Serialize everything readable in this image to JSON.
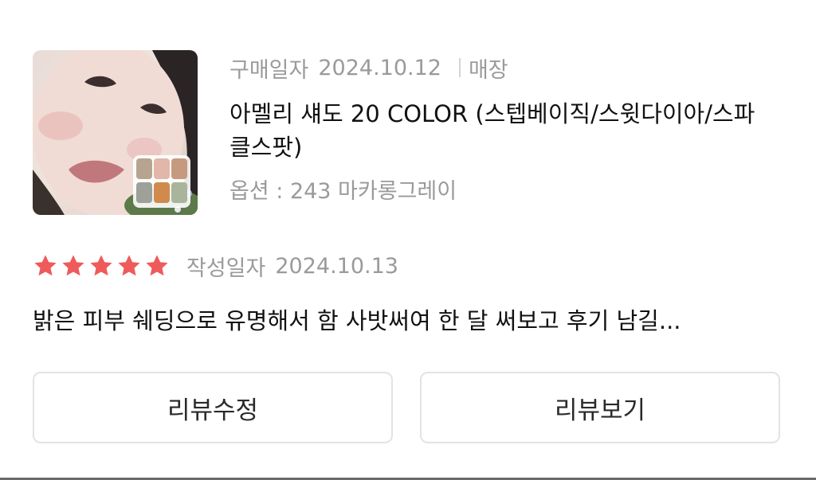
{
  "order": {
    "purchase_label": "구매일자",
    "purchase_date": "2024.10.12",
    "store_label": "매장",
    "product_name": "아멜리 섀도 20 COLOR (스텝베이직/스윗다이아/스파클스팟)",
    "option_text": "옵션 : 243 마카롱그레이"
  },
  "review": {
    "rating": 5,
    "rating_max": 5,
    "star_color": "#ef5a5a",
    "written_label": "작성일자",
    "written_date": "2024.10.13",
    "text": "밝은 피부 쉐딩으로 유명해서 함 사밧써여 한 달 써보고 후기 남길..."
  },
  "buttons": {
    "edit_review": "리뷰수정",
    "view_review": "리뷰보기"
  }
}
